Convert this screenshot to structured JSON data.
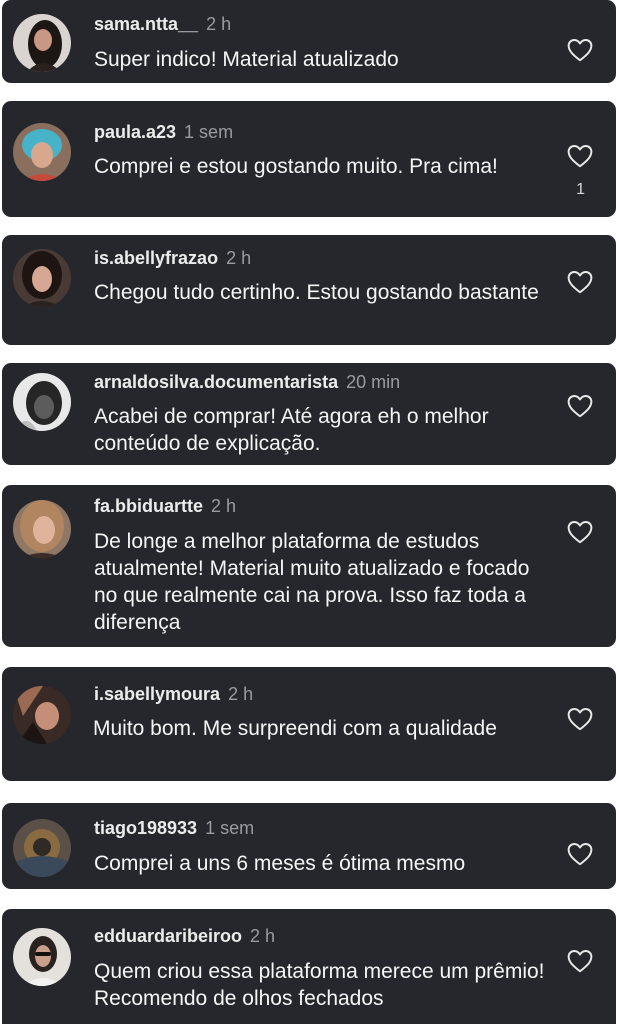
{
  "comments": [
    {
      "username": "sama.ntta__",
      "time": "2 h",
      "text": "Super indico! Material atualizado",
      "likes": "",
      "avatar": "woman-dark-hair-avatar"
    },
    {
      "username": "paula.a23",
      "time": "1 sem",
      "text": "Comprei e estou gostando muito. Pra cima!",
      "likes": "1",
      "avatar": "woman-blue-hair-avatar"
    },
    {
      "username": "is.abellyfrazao",
      "time": "2 h",
      "text": "Chegou tudo certinho. Estou gostando bastante",
      "likes": "",
      "avatar": "woman-brunette-avatar"
    },
    {
      "username": "arnaldosilva.documentarista",
      "time": "20 min",
      "text": "Acabei de comprar! Até agora eh o melhor conteúdo de explicação.",
      "likes": "",
      "avatar": "man-black-white-avatar"
    },
    {
      "username": "fa.bbiduartte",
      "time": "2 h",
      "text": "De longe a melhor plataforma de estudos atualmente! Material muito atualizado e focado no que realmente cai na prova. Isso faz toda a diferença",
      "likes": "",
      "avatar": "woman-blonde-avatar"
    },
    {
      "username": "i.sabellymoura",
      "time": "2 h",
      "text": "Muito bom. Me surpreendi com a qualidade",
      "likes": "",
      "avatar": "woman-selfie-avatar"
    },
    {
      "username": "tiago198933",
      "time": "1 sem",
      "text": "Comprei a uns 6 meses é ótima mesmo",
      "likes": "",
      "avatar": "motorcycle-avatar"
    },
    {
      "username": "edduardaribeiroo",
      "time": "2 h",
      "text": "Quem criou essa plataforma merece um prêmio! Recomendo de olhos fechados",
      "likes": "",
      "avatar": "woman-sunglasses-avatar"
    }
  ],
  "icons": {
    "like": "heart-outline-icon"
  },
  "colors": {
    "card": "#26272c",
    "background": "#ffffff",
    "text": "#f5f5f5",
    "muted": "#9a9a9f"
  }
}
